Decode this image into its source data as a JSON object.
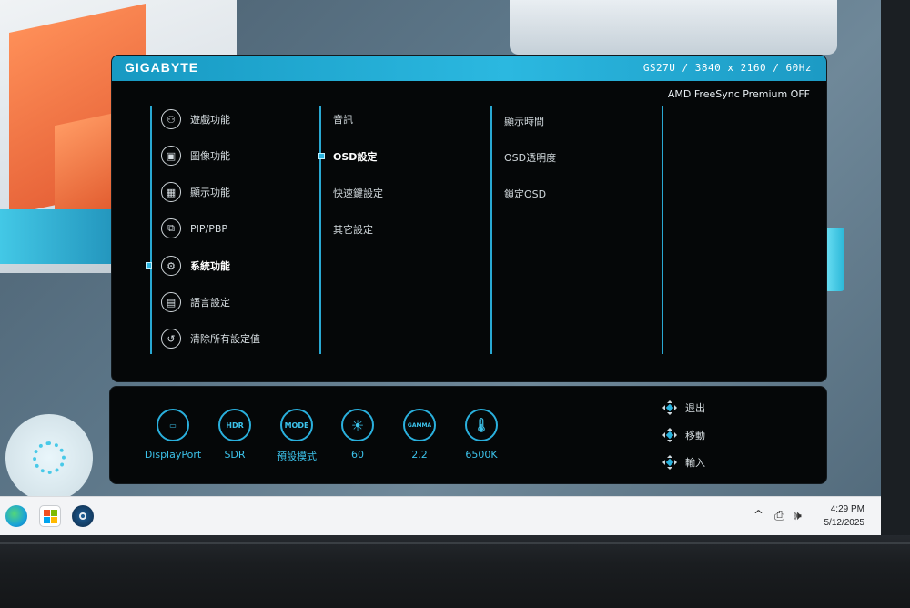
{
  "osd": {
    "brand": "GIGABYTE",
    "model_info": "GS27U / 3840 x 2160 / 60Hz",
    "freesync_status": "AMD FreeSync Premium OFF",
    "main_menu": [
      {
        "label": "遊戲功能",
        "icon": "gamepad-icon",
        "glyph": "⚇"
      },
      {
        "label": "圖像功能",
        "icon": "picture-icon",
        "glyph": "▣"
      },
      {
        "label": "顯示功能",
        "icon": "display-grid-icon",
        "glyph": "▦"
      },
      {
        "label": "PIP/PBP",
        "icon": "pip-icon",
        "glyph": "⧉"
      },
      {
        "label": "系統功能",
        "icon": "gear-icon",
        "glyph": "⚙",
        "selected": true
      },
      {
        "label": "語言設定",
        "icon": "language-icon",
        "glyph": "▤"
      },
      {
        "label": "清除所有設定值",
        "icon": "reset-icon",
        "glyph": "↺"
      }
    ],
    "sub_menu": [
      {
        "label": "音訊"
      },
      {
        "label": "OSD設定",
        "selected": true
      },
      {
        "label": "快速鍵設定"
      },
      {
        "label": "其它設定"
      }
    ],
    "detail_menu": [
      {
        "label": "顯示時間"
      },
      {
        "label": "OSD透明度"
      },
      {
        "label": "鎖定OSD"
      }
    ]
  },
  "status_bar": {
    "items": [
      {
        "icon_text": "▭",
        "label": "DisplayPort",
        "icon": "displayport-icon"
      },
      {
        "icon_text": "HDR",
        "label": "SDR",
        "icon": "hdr-icon"
      },
      {
        "icon_text": "MODE",
        "label": "預設模式",
        "icon": "mode-icon"
      },
      {
        "icon_text": "☀",
        "label": "60",
        "icon": "brightness-icon"
      },
      {
        "icon_text": "GAMMA",
        "label": "2.2",
        "icon": "gamma-icon"
      },
      {
        "icon_text": "🌡",
        "label": "6500K",
        "icon": "color-temp-icon"
      }
    ],
    "nav": [
      {
        "label": "退出"
      },
      {
        "label": "移動"
      },
      {
        "label": "輸入"
      }
    ]
  },
  "taskbar": {
    "time": "4:29 PM",
    "date": "5/12/2025",
    "tray_chevron": "^"
  },
  "colors": {
    "accent": "#2ab4e0",
    "osd_bg": "#050708",
    "header": "#1a9fc9"
  }
}
